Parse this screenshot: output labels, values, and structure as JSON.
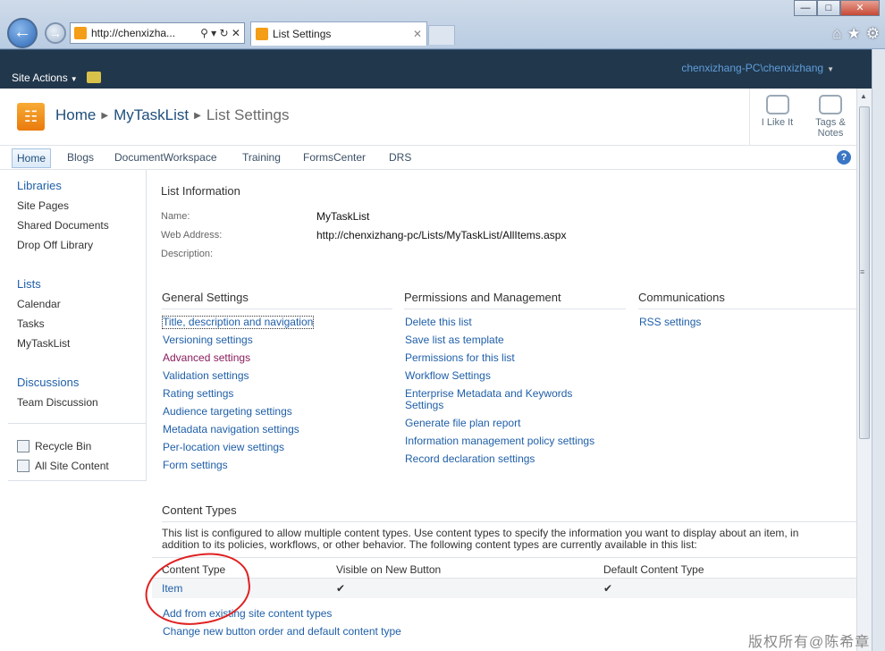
{
  "browser": {
    "address": "http://chenxizha...",
    "address_tools": "⚲ ▾ ↻ ✕",
    "tab_title": "List Settings",
    "window_buttons": [
      "—",
      "□",
      "✕"
    ],
    "toolbar_icons": [
      "home-icon",
      "star-icon",
      "gear-icon"
    ]
  },
  "topbar": {
    "site_actions": "Site Actions",
    "user": "chenxizhang-PC\\chenxizhang"
  },
  "title": {
    "breadcrumb": [
      "Home",
      "MyTaskList",
      "List Settings"
    ],
    "like_label": "I Like It",
    "tags_label_1": "Tags &",
    "tags_label_2": "Notes"
  },
  "topnav": {
    "items": [
      "Home",
      "Blogs",
      "DocumentWorkspace",
      "Training",
      "FormsCenter",
      "DRS"
    ],
    "selected": "Home"
  },
  "leftnav": {
    "libraries_head": "Libraries",
    "libraries": [
      "Site Pages",
      "Shared Documents",
      "Drop Off Library"
    ],
    "lists_head": "Lists",
    "lists": [
      "Calendar",
      "Tasks",
      "MyTaskList"
    ],
    "discussions_head": "Discussions",
    "discussions": [
      "Team Discussion"
    ],
    "recycle_bin": "Recycle Bin",
    "all_site_content": "All Site Content"
  },
  "list_info": {
    "heading": "List Information",
    "name_label": "Name:",
    "name_value": "MyTaskList",
    "web_label": "Web Address:",
    "web_value": "http://chenxizhang-pc/Lists/MyTaskList/AllItems.aspx",
    "desc_label": "Description:"
  },
  "general": {
    "heading": "General Settings",
    "links": [
      "Title, description and navigation",
      "Versioning settings",
      "Advanced settings",
      "Validation settings",
      "Rating settings",
      "Audience targeting settings",
      "Metadata navigation settings",
      "Per-location view settings",
      "Form settings"
    ]
  },
  "permissions": {
    "heading": "Permissions and Management",
    "links": [
      "Delete this list",
      "Save list as template",
      "Permissions for this list",
      "Workflow Settings",
      "Enterprise Metadata and Keywords",
      "Settings",
      "Generate file plan report",
      "Information management policy settings",
      "Record declaration settings"
    ]
  },
  "communications": {
    "heading": "Communications",
    "links": [
      "RSS settings"
    ]
  },
  "content_types": {
    "heading": "Content Types",
    "desc_1": "This list is configured to allow multiple content types. Use content types to specify the information you want to display about an item, in",
    "desc_2": "addition to its policies, workflows, or other behavior. The following content types are currently available in this list:",
    "col_type": "Content Type",
    "col_visible": "Visible on New Button",
    "col_default": "Default Content Type",
    "row_name": "Item",
    "row_visible": "✔",
    "row_default": "✔",
    "add_link": "Add from existing site content types",
    "order_link": "Change new button order and default content type"
  },
  "watermark": "版权所有@陈希章",
  "colors": {
    "link": "#1f5fa8",
    "visited": "#8a1d5c",
    "topbar": "#21374c",
    "annotation": "#e02020"
  }
}
